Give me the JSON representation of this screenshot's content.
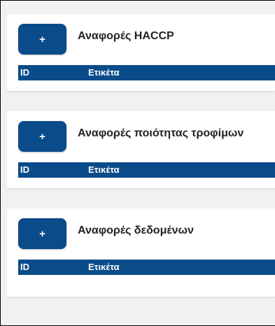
{
  "sections": [
    {
      "add_label": "+",
      "title": "Αναφορές HACCP",
      "columns": [
        "ID",
        "Ετικέτα"
      ]
    },
    {
      "add_label": "+",
      "title": "Αναφορές ποιότητας τροφίμων",
      "columns": [
        "ID",
        "Ετικέτα"
      ]
    },
    {
      "add_label": "+",
      "title": "Αναφορές δεδομένων",
      "columns": [
        "ID",
        "Ετικέτα"
      ]
    }
  ],
  "colors": {
    "primary": "#0a4b8a",
    "background": "#f1f1f1",
    "card": "#ffffff"
  }
}
